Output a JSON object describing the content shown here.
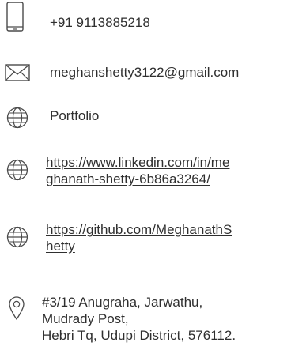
{
  "contacts": {
    "phone": {
      "icon": "smartphone-icon",
      "value": "+91 9113885218"
    },
    "email": {
      "icon": "envelope-icon",
      "value": "meghanshetty3122@gmail.com"
    },
    "portfolio": {
      "icon": "globe-icon",
      "label": "Portfolio"
    },
    "linkedin": {
      "icon": "globe-icon",
      "line1": "https://www.linkedin.com/in/me",
      "line2": "ghanath-shetty-6b86a3264/"
    },
    "github": {
      "icon": "globe-icon",
      "line1": "https://github.com/MeghanathS",
      "line2": "hetty"
    },
    "address": {
      "icon": "map-pin-icon",
      "line1": "#3/19 Anugraha, Jarwathu,",
      "line2": "Mudrady Post,",
      "line3": "Hebri Tq, Udupi District, 576112."
    }
  },
  "colors": {
    "text": "#2f2f2f",
    "icon": "#4a4a4a",
    "background": "#ffffff"
  }
}
